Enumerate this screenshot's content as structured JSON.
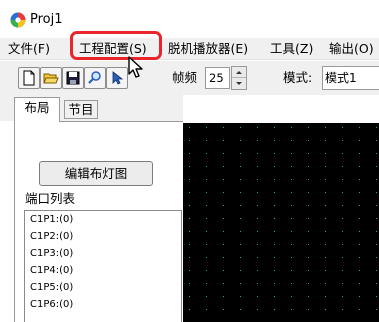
{
  "window": {
    "title": "Proj1"
  },
  "menu": [
    {
      "label": "文件(F)"
    },
    {
      "label": "工程配置(S)"
    },
    {
      "label": "脱机播放器(E)"
    },
    {
      "label": "工具(Z)"
    },
    {
      "label": "输出(O)"
    }
  ],
  "toolbar": {
    "buttons": [
      "new-file-icon",
      "open-folder-icon",
      "save-icon",
      "search-icon",
      "pointer-icon"
    ],
    "fps_label": "帧频",
    "fps_value": "25",
    "mode_label": "模式:",
    "mode_value": "模式1"
  },
  "tabs": [
    {
      "label": "布局",
      "active": true
    },
    {
      "label": "节目",
      "active": false
    }
  ],
  "panel": {
    "edit_button": "编辑布灯图",
    "port_list_label": "端口列表",
    "ports": [
      "C1P1:(0)",
      "C1P2:(0)",
      "C1P3:(0)",
      "C1P4:(0)",
      "C1P5:(0)",
      "C1P6:(0)"
    ]
  },
  "colors": {
    "highlight": "#e8262c",
    "canvas_bg": "#000000",
    "grid_dot": "#1fa7a7"
  }
}
